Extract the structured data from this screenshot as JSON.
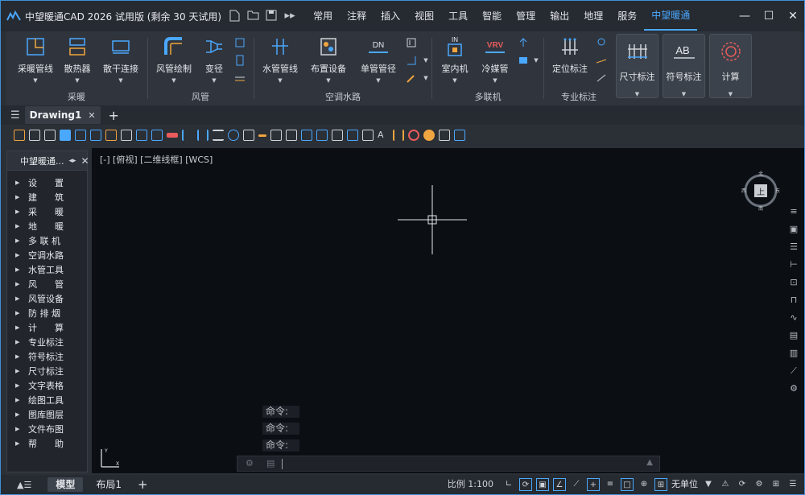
{
  "app": {
    "title": "中望暖通CAD 2026 试用版 (剩余 30 天试用)",
    "accent": "#4aa8ff"
  },
  "quick_access": [
    "new-file-icon",
    "open-folder-icon",
    "save-icon",
    "more-icon"
  ],
  "menus": [
    "常用",
    "注释",
    "插入",
    "视图",
    "工具",
    "智能",
    "管理",
    "输出",
    "地理",
    "服务",
    "中望暖通"
  ],
  "active_menu": "中望暖通",
  "ribbon": {
    "groups": {
      "heating": "采暖",
      "duct": "风管",
      "water": "空调水路",
      "vrf": "多联机",
      "annot": "专业标注"
    },
    "buttons": {
      "heating_pipe": "采暖管线",
      "radiator": "散热器",
      "riser_connect": "散干连接",
      "duct_draw": "风管绘制",
      "reducer": "变径",
      "water_pipe": "水管管线",
      "equipment": "布置设备",
      "pipe_dia": "单管管径",
      "indoor_unit": "室内机",
      "refrigerant": "冷媒管",
      "position_mark": "定位标注",
      "dim_mark": "尺寸标注",
      "symbol_mark": "符号标注",
      "calculate": "计算"
    },
    "icon_text": {
      "dn": "DN",
      "vrv": "VRV",
      "in": "IN",
      "ab": "AB"
    }
  },
  "doc_tab": {
    "name": "Drawing1"
  },
  "palette": {
    "title": "中望暖通...",
    "items": [
      "设　　置",
      "建　　筑",
      "采　　暖",
      "地　　暖",
      "多 联 机",
      "空调水路",
      "水管工具",
      "风　　管",
      "风管设备",
      "防 排 烟",
      "计　　算",
      "专业标注",
      "符号标注",
      "尺寸标注",
      "文字表格",
      "绘图工具",
      "图库图层",
      "文件布图",
      "帮　　助"
    ]
  },
  "viewport": {
    "label": "[-] [俯视] [二维线框] [WCS]",
    "viewcube_face": "上",
    "compass": {
      "n": "北",
      "s": "南",
      "e": "东",
      "w": "西"
    },
    "ucs_y": "Y",
    "ucs_x": "X"
  },
  "command": {
    "lines": [
      "命令:",
      "命令:",
      "命令:"
    ]
  },
  "status": {
    "tabs": [
      "模型",
      "布局1"
    ],
    "scale_label": "比例 1:100",
    "unit": "无单位"
  }
}
